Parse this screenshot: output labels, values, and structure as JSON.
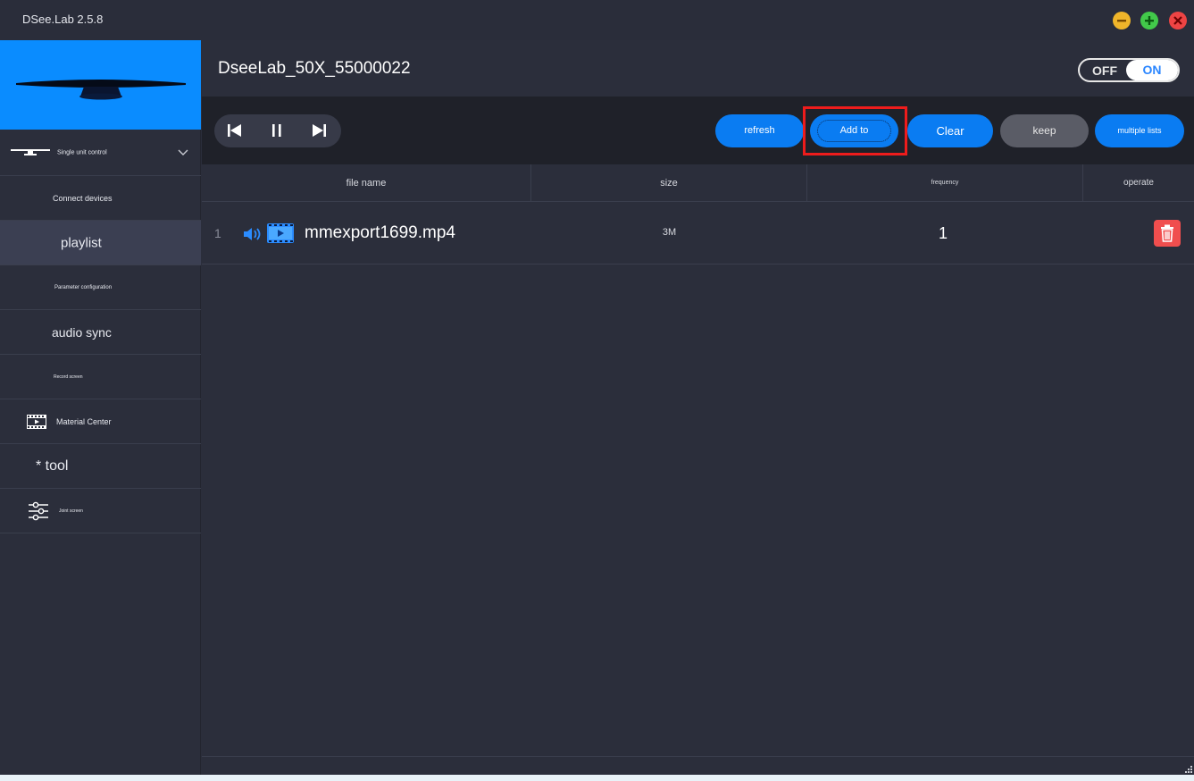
{
  "window": {
    "title": "DSee.Lab 2.5.8"
  },
  "sidebar": {
    "items": [
      {
        "label": "Single unit control",
        "icon": "monitor-icon"
      },
      {
        "label": "Connect devices"
      },
      {
        "label": "playlist"
      },
      {
        "label": "Parameter configuration"
      },
      {
        "label": "audio sync"
      },
      {
        "label": "Record screen"
      },
      {
        "label": "Material Center",
        "icon": "film-icon"
      },
      {
        "label": "* tool"
      },
      {
        "label": "Joint screen",
        "icon": "sliders-icon"
      }
    ]
  },
  "header": {
    "device_name": "DseeLab_50X_55000022",
    "toggle": {
      "off_label": "OFF",
      "on_label": "ON",
      "state": "on"
    }
  },
  "toolbar": {
    "refresh": "refresh",
    "add_to": "Add to",
    "clear": "Clear",
    "keep": "keep",
    "multiple_lists": "multiple lists",
    "accent_color": "#0a7cf2"
  },
  "table": {
    "headers": {
      "file_name": "file name",
      "size": "size",
      "frequency": "frequency",
      "operate": "operate"
    },
    "rows": [
      {
        "index": "1",
        "file_name": "mmexport1699.mp4",
        "size": "3M",
        "frequency": "1"
      }
    ]
  }
}
